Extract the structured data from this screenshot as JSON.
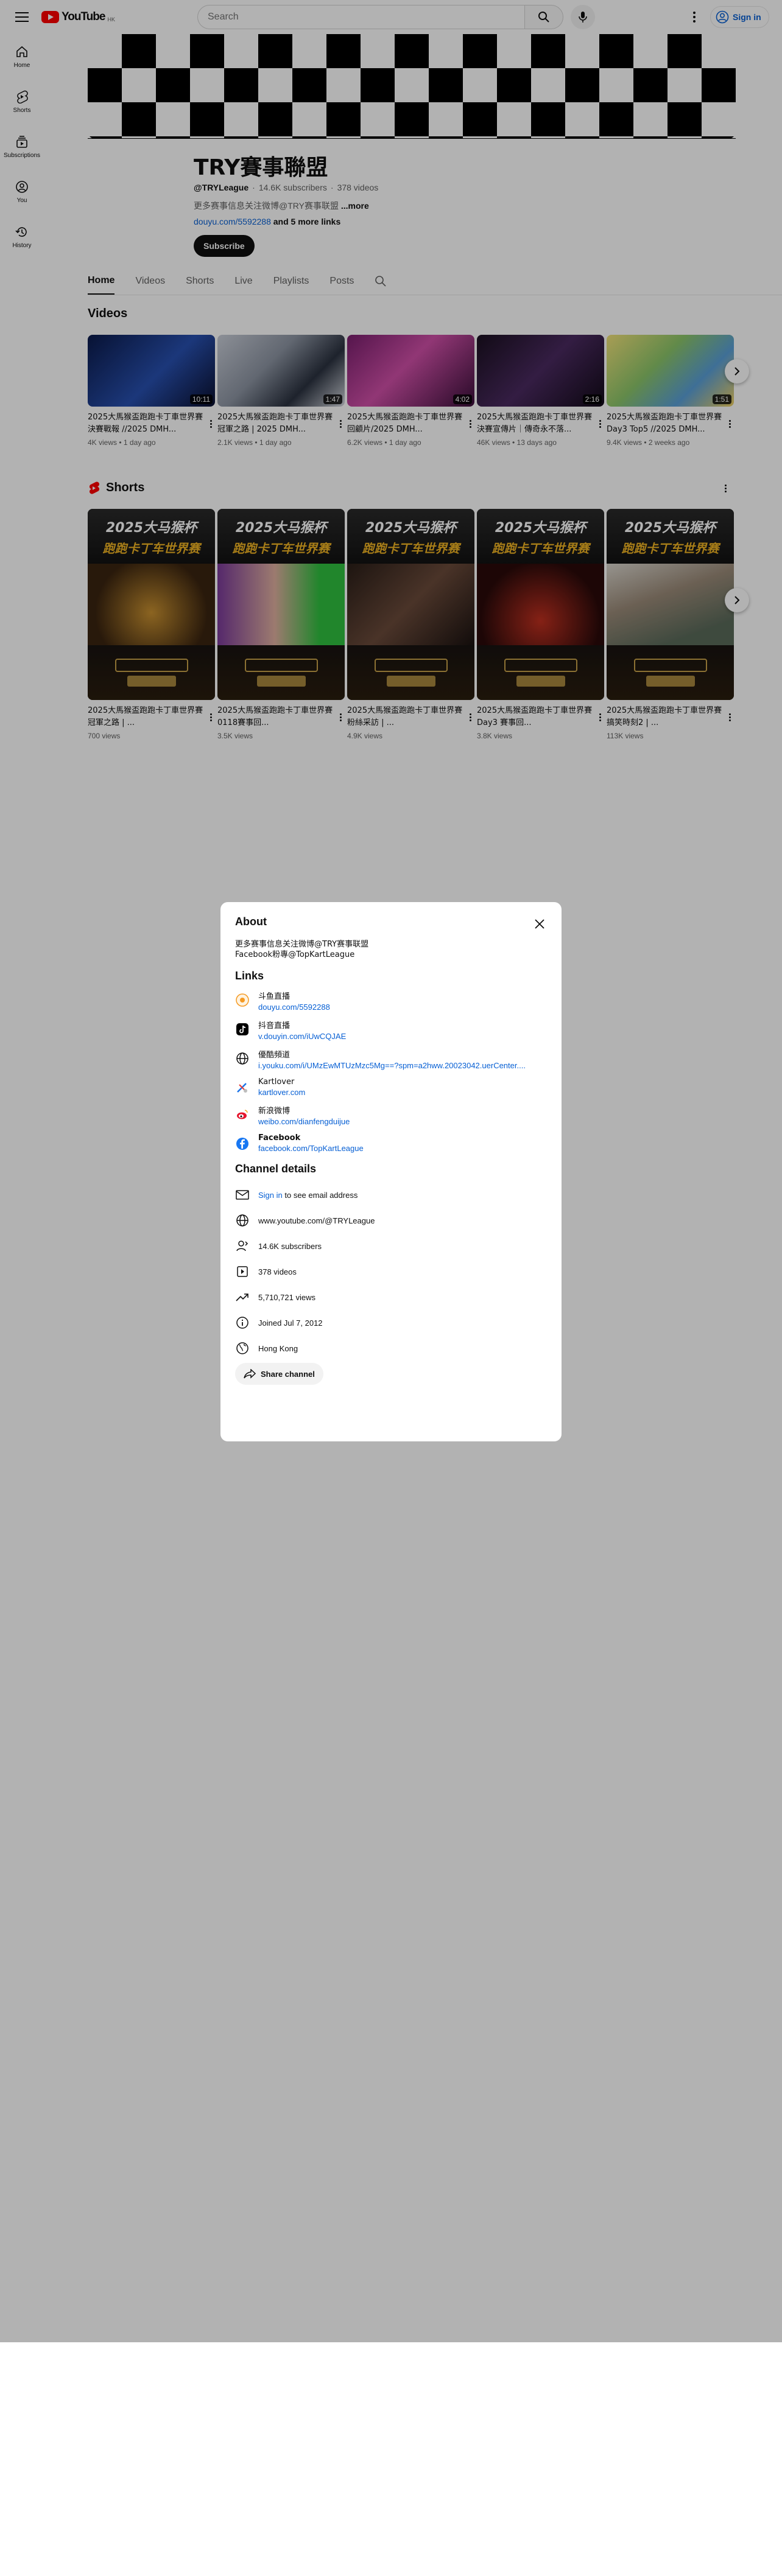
{
  "header": {
    "logo_text": "YouTube",
    "logo_region": "HK",
    "search_placeholder": "Search",
    "signin_label": "Sign in"
  },
  "sidebar": {
    "items": [
      {
        "label": "Home",
        "icon": "home-icon"
      },
      {
        "label": "Shorts",
        "icon": "shorts-icon"
      },
      {
        "label": "Subscriptions",
        "icon": "subscriptions-icon"
      },
      {
        "label": "You",
        "icon": "you-icon"
      },
      {
        "label": "History",
        "icon": "history-icon"
      }
    ]
  },
  "channel": {
    "name": "TRY賽事聯盟",
    "handle": "@TRYLeague",
    "subscribers": "14.6K subscribers",
    "videos_count": "378 videos",
    "meta_sep": "·",
    "description_snippet": "更多赛事信息关注微博@TRY赛事联盟",
    "more_label": "...more",
    "link_primary": "douyu.com/5592288",
    "link_more": "and 5 more links",
    "subscribe_label": "Subscribe"
  },
  "tabs": [
    "Home",
    "Videos",
    "Shorts",
    "Live",
    "Playlists",
    "Posts"
  ],
  "videos_section": {
    "title": "Videos",
    "items": [
      {
        "title": "2025大馬猴盃跑跑卡丁車世界賽 決賽戰報 //2025 DMH...",
        "meta": "4K views • 1 day ago",
        "duration": "10:11"
      },
      {
        "title": "2025大馬猴盃跑跑卡丁車世界賽 冠軍之路 | 2025 DMH...",
        "meta": "2.1K views • 1 day ago",
        "duration": "1:47"
      },
      {
        "title": "2025大馬猴盃跑跑卡丁車世界賽 回顧片/2025 DMH...",
        "meta": "6.2K views • 1 day ago",
        "duration": "4:02"
      },
      {
        "title": "2025大馬猴盃跑跑卡丁車世界賽 決賽宣傳片｜傳奇永不落...",
        "meta": "46K views • 13 days ago",
        "duration": "2:16"
      },
      {
        "title": "2025大馬猴盃跑跑卡丁車世界賽 Day3 Top5 //2025 DMH...",
        "meta": "9.4K views • 2 weeks ago",
        "duration": "1:51"
      }
    ]
  },
  "shorts_section": {
    "title": "Shorts",
    "thumb_line1": "2025大马猴杯",
    "thumb_line2": "跑跑卡丁车世界赛",
    "items": [
      {
        "title": "2025大馬猴盃跑跑卡丁車世界賽 冠軍之路 | ...",
        "views": "700 views"
      },
      {
        "title": "2025大馬猴盃跑跑卡丁車世界賽 0118賽事回...",
        "views": "3.5K views"
      },
      {
        "title": "2025大馬猴盃跑跑卡丁車世界賽 粉絲采訪 | ...",
        "views": "4.9K views"
      },
      {
        "title": "2025大馬猴盃跑跑卡丁車世界賽 Day3 賽事回...",
        "views": "3.8K views"
      },
      {
        "title": "2025大馬猴盃跑跑卡丁車世界賽 搞笑時刻2 | ...",
        "views": "113K views"
      }
    ]
  },
  "about": {
    "title": "About",
    "description": [
      "更多赛事信息关注微博@TRY赛事联盟",
      "Facebook粉專@TopKartLeague"
    ],
    "links_heading": "Links",
    "links": [
      {
        "name": "斗鱼直播",
        "url": "douyu.com/5592288",
        "icon": "douyu-icon"
      },
      {
        "name": "抖音直播",
        "url": "v.douyin.com/iUwCQJAE",
        "icon": "douyin-icon"
      },
      {
        "name": "優酷頻道",
        "url": "i.youku.com/i/UMzEwMTUzMzc5Mg==?spm=a2hww.20023042.uerCenter....",
        "icon": "globe-icon"
      },
      {
        "name": "Kartlover",
        "url": "kartlover.com",
        "icon": "kartlover-icon"
      },
      {
        "name": "新浪微博",
        "url": "weibo.com/dianfengduijue",
        "icon": "weibo-icon"
      },
      {
        "name": "Facebook",
        "url": "facebook.com/TopKartLeague",
        "icon": "facebook-icon"
      }
    ],
    "details_heading": "Channel details",
    "signin_link": "Sign in",
    "email_text": "to see email address",
    "url": "www.youtube.com/@TRYLeague",
    "subscribers": "14.6K subscribers",
    "videos": "378 videos",
    "views": "5,710,721 views",
    "joined": "Joined Jul 7, 2012",
    "country": "Hong Kong",
    "share_label": "Share channel"
  },
  "colors": {
    "brand_red": "#ff0000",
    "link_blue": "#065fd4",
    "text_primary": "#0f0f0f",
    "text_secondary": "#606060"
  }
}
